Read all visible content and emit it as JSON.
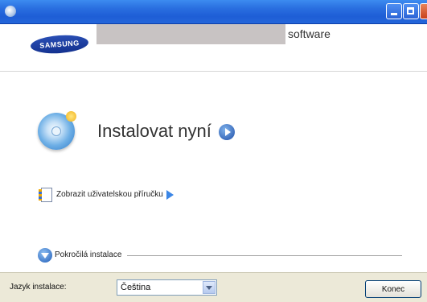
{
  "window": {
    "title": ""
  },
  "header": {
    "logo_text": "SAMSUNG",
    "product_suffix": "software"
  },
  "main": {
    "install_now_label": "Instalovat nyní",
    "user_guide_label": "Zobrazit uživatelskou příručku",
    "advanced_install_label": "Pokročilá instalace"
  },
  "footer": {
    "language_label": "Jazyk instalace:",
    "language_value": "Čeština",
    "exit_button_label": "Konec"
  },
  "colors": {
    "titlebar": "#2a6fe0",
    "brand": "#1a3a9e",
    "footer_bg": "#ece9d8"
  },
  "icons": {
    "window_icon": "app-icon",
    "install": "install-disc-icon",
    "go": "arrow-right-circle-icon",
    "guide": "manual-book-icon",
    "guide_arrow": "triangle-right-icon",
    "advanced": "arrow-down-circle-icon"
  }
}
